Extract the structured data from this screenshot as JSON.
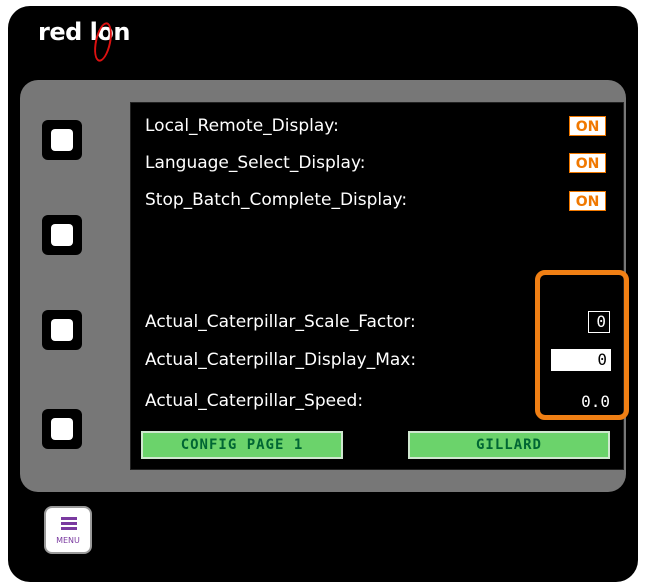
{
  "brand": {
    "part1": "red l",
    "part2": "on"
  },
  "display": {
    "toggles": [
      {
        "label": "Local_Remote_Display:",
        "value": "ON"
      },
      {
        "label": "Language_Select_Display:",
        "value": "ON"
      },
      {
        "label": "Stop_Batch_Complete_Display:",
        "value": "ON"
      }
    ],
    "fields": [
      {
        "label": "Actual_Caterpillar_Scale_Factor:",
        "value": "0"
      },
      {
        "label": "Actual_Caterpillar_Display_Max:",
        "value": "0"
      },
      {
        "label": "Actual_Caterpillar_Speed:",
        "value": "0.0"
      }
    ],
    "buttons": {
      "left": "CONFIG PAGE 1",
      "right": "GILLARD"
    }
  },
  "menu_key": {
    "label": "MENU"
  },
  "colors": {
    "accent": "#f07f14",
    "button_green": "#6bd36b",
    "bezel": "#777777"
  }
}
